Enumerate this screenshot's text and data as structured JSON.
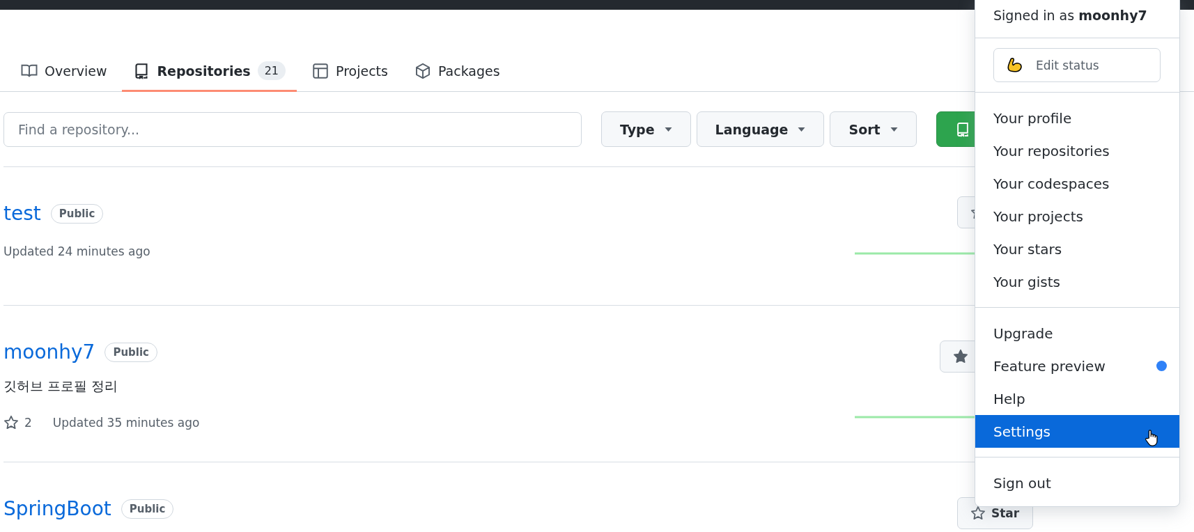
{
  "tabs": [
    {
      "label": "Overview",
      "selected": false
    },
    {
      "label": "Repositories",
      "count": "21",
      "selected": true
    },
    {
      "label": "Projects",
      "selected": false
    },
    {
      "label": "Packages",
      "selected": false
    }
  ],
  "search": {
    "placeholder": "Find a repository..."
  },
  "filters": [
    "Type",
    "Language",
    "Sort"
  ],
  "repositories": [
    {
      "name": "test",
      "visibility": "Public",
      "updated": "Updated 24 minutes ago",
      "starred": false,
      "activity_graph": true
    },
    {
      "name": "moonhy7",
      "visibility": "Public",
      "description": "깃허브 프로필 정리",
      "star_count": "2",
      "updated": "Updated 35 minutes ago",
      "starred": true,
      "activity_graph": true
    },
    {
      "name": "SpringBoot",
      "visibility": "Public",
      "starred": false,
      "star_label": "Star"
    }
  ],
  "user_menu": {
    "signed_in_prefix": "Signed in as",
    "username": "moonhy7",
    "status_button": "Edit status",
    "sections": [
      [
        {
          "label": "Your profile",
          "selected": false
        },
        {
          "label": "Your repositories",
          "selected": false
        },
        {
          "label": "Your codespaces",
          "selected": false
        },
        {
          "label": "Your projects",
          "selected": false
        },
        {
          "label": "Your stars",
          "selected": false
        },
        {
          "label": "Your gists",
          "selected": false
        }
      ],
      [
        {
          "label": "Upgrade",
          "selected": false
        },
        {
          "label": "Feature preview",
          "selected": false,
          "new_dot": true
        },
        {
          "label": "Help",
          "selected": false
        },
        {
          "label": "Settings",
          "selected": true
        }
      ],
      [
        {
          "label": "Sign out",
          "selected": false
        }
      ]
    ]
  }
}
